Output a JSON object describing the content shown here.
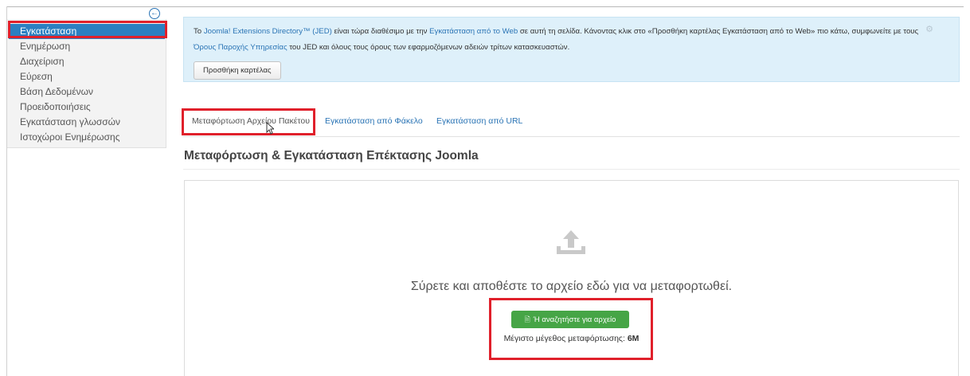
{
  "sidebar": {
    "items": [
      {
        "label": "Εγκατάσταση",
        "active": true
      },
      {
        "label": "Ενημέρωση"
      },
      {
        "label": "Διαχείριση"
      },
      {
        "label": "Εύρεση"
      },
      {
        "label": "Βάση Δεδομένων"
      },
      {
        "label": "Προειδοποιήσεις"
      },
      {
        "label": "Εγκατάσταση γλωσσών"
      },
      {
        "label": "Ιστοχώροι Ενημέρωσης"
      }
    ],
    "collapse_icon": "arrow-left-circle-icon"
  },
  "jed_notice": {
    "t1": "Το ",
    "link1": "Joomla! Extensions Directory™ (JED)",
    "t2": " είναι τώρα διαθέσιμο με την ",
    "link2": "Εγκατάσταση από το Web",
    "t3": " σε αυτή τη σελίδα. Κάνοντας κλικ στο «Προσθήκη καρτέλας Εγκατάσταση από το Web» πιο κάτω, συμφωνείτε με τους ",
    "link3": "Όρους Παροχής Υπηρεσίας",
    "t4": " του JED και όλους τους όρους των εφαρμοζόμενων αδειών τρίτων κατασκευαστών.",
    "button": "Προσθήκη καρτέλας",
    "settings_icon": "gear-icon"
  },
  "tabs": [
    {
      "label": "Μεταφόρτωση Αρχείου Πακέτου",
      "active": true
    },
    {
      "label": "Εγκατάσταση από Φάκελο"
    },
    {
      "label": "Εγκατάσταση από URL"
    }
  ],
  "section_title": "Μεταφόρτωση & Εγκατάσταση Επέκτασης Joomla",
  "upload": {
    "icon": "upload-icon",
    "drop_text": "Σύρετε και αποθέστε το αρχείο εδώ για να μεταφορτωθεί.",
    "browse_button": "Ή αναζητήστε για αρχείο",
    "max_size_label": "Μέγιστο μέγεθος μεταφόρτωσης:",
    "max_size_value": "6M"
  },
  "colors": {
    "accent": "#2b7fc1",
    "highlight": "#e0202b",
    "success": "#46a546",
    "info_bg": "#def0fa"
  }
}
